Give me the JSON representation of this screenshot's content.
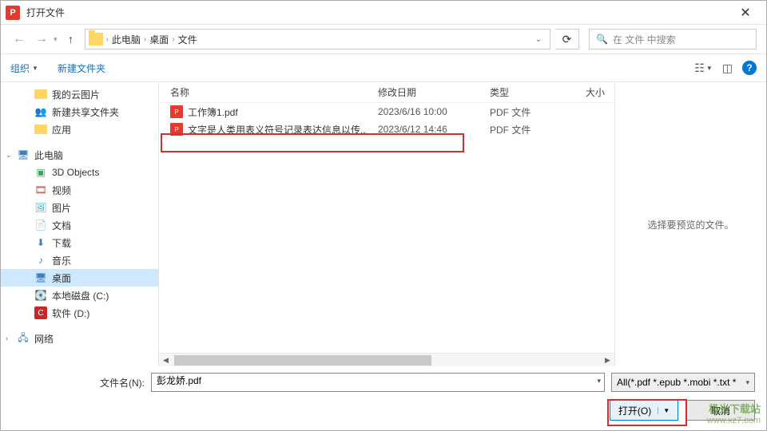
{
  "title": "打开文件",
  "app_icon_letter": "P",
  "breadcrumb": {
    "items": [
      "此电脑",
      "桌面",
      "文件"
    ]
  },
  "search": {
    "placeholder": "在 文件 中搜索"
  },
  "toolbar": {
    "organize": "组织",
    "new_folder": "新建文件夹"
  },
  "columns": {
    "name": "名称",
    "date": "修改日期",
    "type": "类型",
    "size": "大小"
  },
  "sidebar": {
    "quick": [
      {
        "label": "我的云图片",
        "icon": "folder"
      },
      {
        "label": "新建共享文件夹",
        "icon": "share"
      },
      {
        "label": "应用",
        "icon": "folder"
      }
    ],
    "pc_label": "此电脑",
    "pc_children": [
      {
        "label": "3D Objects",
        "icon": "3d"
      },
      {
        "label": "视频",
        "icon": "video"
      },
      {
        "label": "图片",
        "icon": "pic"
      },
      {
        "label": "文档",
        "icon": "doc"
      },
      {
        "label": "下载",
        "icon": "dl"
      },
      {
        "label": "音乐",
        "icon": "music"
      },
      {
        "label": "桌面",
        "icon": "desk",
        "selected": true
      },
      {
        "label": "本地磁盘 (C:)",
        "icon": "disk"
      },
      {
        "label": "软件 (D:)",
        "icon": "sw"
      }
    ],
    "network_label": "网络"
  },
  "files": [
    {
      "name": "工作簿1.pdf",
      "date": "2023/6/16 10:00",
      "type": "PDF 文件"
    },
    {
      "name": "文字是人类用表义符号记录表达信息以传...",
      "date": "2023/6/12 14:46",
      "type": "PDF 文件"
    }
  ],
  "preview_text": "选择要预览的文件。",
  "footer": {
    "filename_label": "文件名(N):",
    "filename_value": "彭龙娇.pdf",
    "filter": "All(*.pdf *.epub *.mobi *.txt *",
    "open": "打开(O)",
    "cancel": "取消"
  },
  "watermark": {
    "line1": "极光下载站",
    "line2": "www.xz7.com"
  }
}
